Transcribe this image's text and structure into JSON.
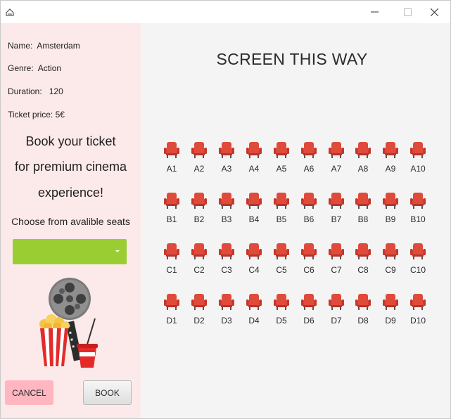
{
  "window": {
    "controls": {
      "minimize": "—",
      "maximize": "☐",
      "close": "✕"
    }
  },
  "movie": {
    "name_label": "Name:",
    "name": "Amsterdam",
    "genre_label": "Genre:",
    "genre": "Action",
    "duration_label": "Duration:",
    "duration": "120",
    "price_label": "Ticket price:",
    "price": "5€"
  },
  "promo": {
    "line1": "Book your ticket",
    "line2": "for premium cinema",
    "line3": "experience!"
  },
  "seat_picker": {
    "label": "Choose from avalible seats",
    "selected": "",
    "color": "#9acd32"
  },
  "illustration": {
    "icon": "film-reel-popcorn-drink-icon"
  },
  "buttons": {
    "cancel": "CANCEL",
    "book": "BOOK",
    "cancel_color": "#ffb6c1"
  },
  "screen_label": "SCREEN THIS WAY",
  "seat_color": "#e04a3a",
  "seat_rows": [
    {
      "row": "A",
      "seats": [
        "A1",
        "A2",
        "A3",
        "A4",
        "A5",
        "A6",
        "A7",
        "A8",
        "A9",
        "A10"
      ]
    },
    {
      "row": "B",
      "seats": [
        "B1",
        "B2",
        "B3",
        "B4",
        "B5",
        "B6",
        "B7",
        "B8",
        "B9",
        "B10"
      ]
    },
    {
      "row": "C",
      "seats": [
        "C1",
        "C2",
        "C3",
        "C4",
        "C5",
        "C6",
        "C7",
        "C8",
        "C9",
        "C10"
      ]
    },
    {
      "row": "D",
      "seats": [
        "D1",
        "D2",
        "D3",
        "D4",
        "D5",
        "D6",
        "D7",
        "D8",
        "D9",
        "D10"
      ]
    }
  ]
}
